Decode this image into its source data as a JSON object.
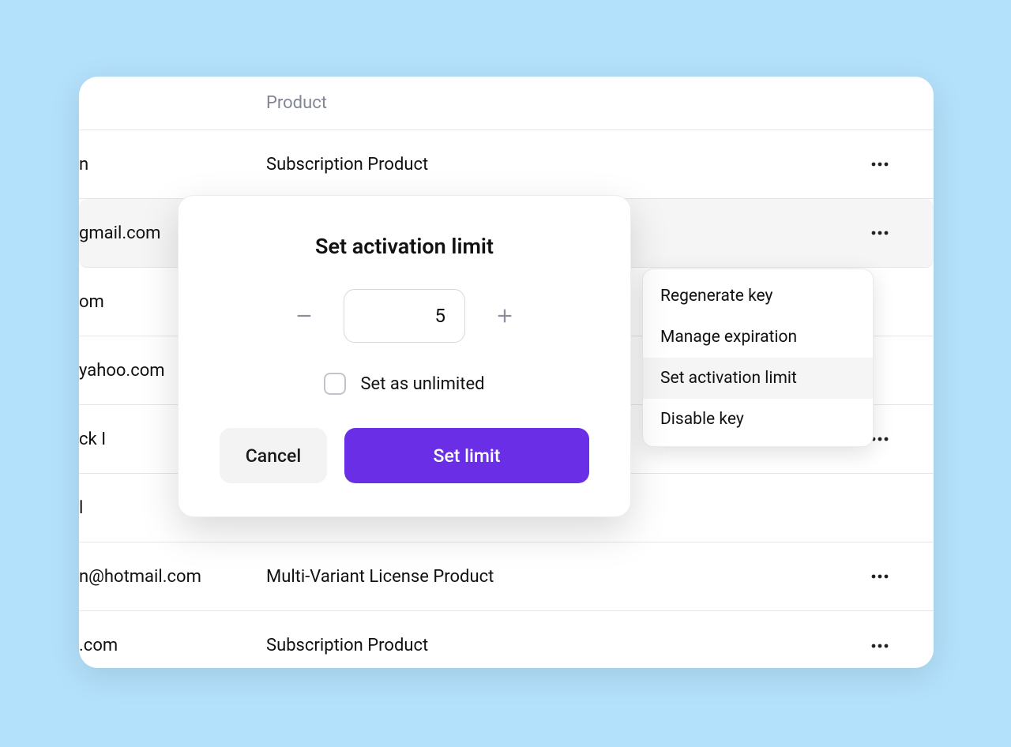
{
  "table": {
    "header": {
      "product": "Product"
    },
    "rows": [
      {
        "email": "n",
        "product": "Subscription Product"
      },
      {
        "email": "gmail.com",
        "product": ""
      },
      {
        "email": "om",
        "product": ""
      },
      {
        "email": "yahoo.com",
        "product": ""
      },
      {
        "email": "ck I",
        "product": ""
      },
      {
        "email": "l",
        "product": ""
      },
      {
        "email": "n@hotmail.com",
        "product": "Multi-Variant License Product"
      },
      {
        "email": ".com",
        "product": "Subscription Product"
      }
    ]
  },
  "dropdown": {
    "items": [
      {
        "label": "Regenerate key",
        "selected": false
      },
      {
        "label": "Manage expiration",
        "selected": false
      },
      {
        "label": "Set activation limit",
        "selected": true
      },
      {
        "label": "Disable key",
        "selected": false
      }
    ]
  },
  "modal": {
    "title": "Set activation limit",
    "value": "5",
    "unlimited_label": "Set as unlimited",
    "cancel_label": "Cancel",
    "submit_label": "Set limit"
  }
}
